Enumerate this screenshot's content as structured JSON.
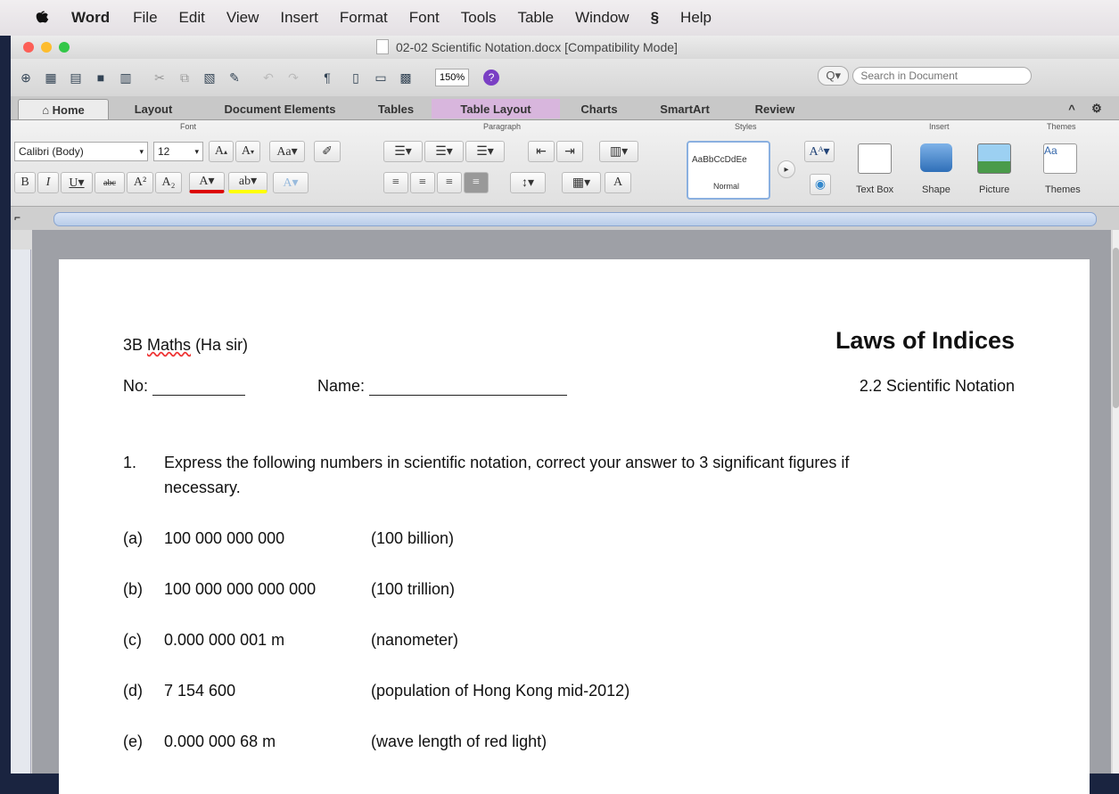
{
  "menubar": {
    "app": "Word",
    "items": [
      "File",
      "Edit",
      "View",
      "Insert",
      "Format",
      "Font",
      "Tools",
      "Table",
      "Window",
      "Help"
    ]
  },
  "window": {
    "title": "02-02 Scientific Notation.docx [Compatibility Mode]"
  },
  "toolbar": {
    "zoom": "150%",
    "search_placeholder": "Search in Document"
  },
  "ribbon_tabs": [
    "Home",
    "Layout",
    "Document Elements",
    "Tables",
    "Table Layout",
    "Charts",
    "SmartArt",
    "Review"
  ],
  "ribbon": {
    "group_font": "Font",
    "group_paragraph": "Paragraph",
    "group_styles": "Styles",
    "group_insert": "Insert",
    "group_themes": "Themes",
    "font_name": "Calibri (Body)",
    "font_size": "12",
    "style_preview": "AaBbCcDdEe",
    "style_name": "Normal",
    "text_box": "Text Box",
    "shape": "Shape",
    "picture": "Picture",
    "themes": "Themes"
  },
  "document": {
    "class_label": "3B ",
    "class_label_spell": "Maths",
    "class_label_rest": " (Ha sir)",
    "title": "Laws of Indices",
    "no_label": "No:",
    "name_label": "Name:",
    "subtitle": "2.2 Scientific Notation",
    "q_number": "1.",
    "q_text": "Express the following numbers in scientific notation, correct your answer to 3 significant figures if",
    "q_text2": "necessary.",
    "items": [
      {
        "label": "(a)",
        "value": "100 000 000 000",
        "note": "(100 billion)"
      },
      {
        "label": "(b)",
        "value": "100 000 000 000 000",
        "note": "(100 trillion)"
      },
      {
        "label": "(c)",
        "value": "0.000 000 001 m",
        "note": "(nanometer)"
      },
      {
        "label": "(d)",
        "value": "7 154 600",
        "note": "(population of Hong Kong mid-2012)"
      },
      {
        "label": "(e)",
        "value": "0.000 000 68 m",
        "note": "(wave length of red light)"
      }
    ]
  }
}
